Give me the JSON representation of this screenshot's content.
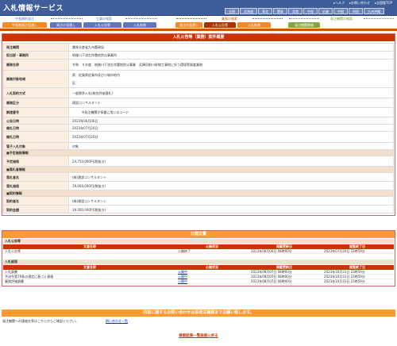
{
  "header": {
    "title": "入札情報サービス",
    "links": [
      "ヘルプ",
      "お問い合わせ",
      "全国版TOP"
    ],
    "regions": [
      "全国",
      "北海道",
      "東北",
      "関東",
      "北陸",
      "中部",
      "近畿",
      "中国",
      "四国",
      "九州沖縄"
    ]
  },
  "nav": {
    "groups": [
      {
        "caption": "中長期的発注",
        "tabs": [
          "中長期発注見通し"
        ]
      },
      {
        "caption": "工事の検索",
        "tabs": [
          "発注の見通し",
          "入札公告等",
          "入札結果"
        ]
      },
      {
        "caption": "業務の検索",
        "tabs": [
          "発注の見通し",
          "入札公告等",
          "入札結果"
        ]
      },
      {
        "caption": "発注機関の検索",
        "tabs": [
          "発注機関情報"
        ]
      }
    ]
  },
  "main": {
    "title": "入札公告等（業務）案件概要",
    "fields": [
      {
        "label": "発注機関",
        "value": "農林水産省九州農政局"
      },
      {
        "label": "担当部・事務所",
        "value": "筑後川下流左岸農地防災事業所"
      },
      {
        "label": "業務名称",
        "value": "令和　５年度　筑後川下流左岸農地防災事業　兵庫田前川幹線工事他に伴う環境等調査業務"
      },
      {
        "label": "業務対象地域",
        "value": "県：佐賀県佐賀市及び小城市地内",
        "value2": "区："
      },
      {
        "label": "入札契約方式",
        "value": "一般競争入札(総合評価落札)"
      },
      {
        "label": "業務区分",
        "value": "建設コンサルタント"
      },
      {
        "label": "調達番号",
        "value": "　　　※発注機関が採番に用いるコード"
      },
      {
        "label": "公告日時",
        "value": "2023年06月06日"
      },
      {
        "label": "開札日時",
        "value": "2023年07月20日"
      },
      {
        "label": "開札日時",
        "value": "2023年07月20日"
      },
      {
        "label": "電子入札対象",
        "value": "対象"
      }
    ],
    "sec_estimate": "■予定価格情報",
    "estimate_label": "予定価格",
    "estimate_value": "24,750,000円(税抜き)",
    "sec_winner": "■落札者情報",
    "winner_label": "落札者名",
    "winner_value": "(株)建設コンサルタント",
    "winning_price_label": "落札価格",
    "winning_price_value": "19,000,000円(税抜き)",
    "sec_contract": "■契約情報",
    "contractor_label": "契約者名",
    "contractor_value": "(株)建設コンサルタント",
    "contract_amount_label": "契約金額",
    "contract_amount_value": "19,000,000円(税抜き)"
  },
  "docs": {
    "title": "公開文書",
    "sec1": "入札公告等",
    "headers": [
      "文書名称",
      "公開状況",
      "掲載更新日",
      "閲覧終了日"
    ],
    "rows1": [
      {
        "name": "入札公告等",
        "status": "公開終了",
        "updated": "2023年06月06日 08時00分",
        "end": "2023年07月20日 23時59分"
      }
    ],
    "sec2": "入札経過",
    "rows2": [
      {
        "name": "入札調書",
        "status": "公開中",
        "updated": "2023年08月07日 08時00分",
        "end": "2023年10月31日 23時59分"
      },
      {
        "name": "予決令第79条の規定に基づく資格",
        "status": "公開中",
        "updated": "2023年08月07日 08時00分",
        "end": "2023年10月31日 23時59分"
      },
      {
        "name": "業務評価調書",
        "status": "公開中",
        "updated": "2023年08月07日 08時00分",
        "end": "2023年10月31日 23時59分"
      }
    ]
  },
  "inquiry": {
    "title": "内容に関するお問い合わせは各発注機関までお願い致します。",
    "text": "発注機関への連絡先等はこちらからご確認ください。",
    "link": "問い合わせ一覧"
  },
  "back_link": "検索結果一覧画面に戻る"
}
